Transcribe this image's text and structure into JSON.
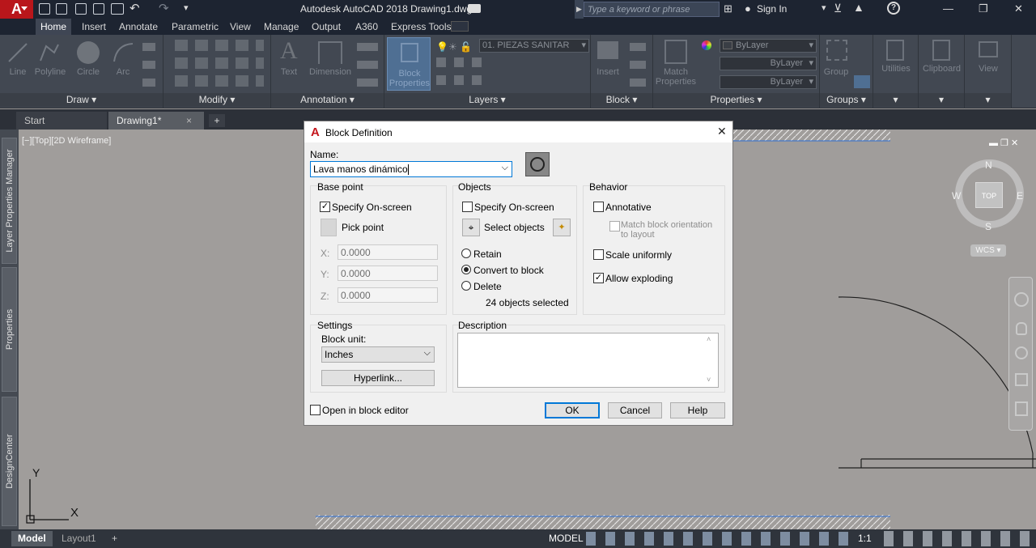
{
  "app": {
    "logo": "A",
    "title": "Autodesk AutoCAD 2018    Drawing1.dwg",
    "search_placeholder": "Type a keyword or phrase",
    "sign_in": "Sign In"
  },
  "ribbon": {
    "tabs": [
      "Home",
      "Insert",
      "Annotate",
      "Parametric",
      "View",
      "Manage",
      "Output",
      "A360",
      "Express Tools"
    ],
    "active_tab": "Home",
    "draw": {
      "label": "Draw",
      "tools": [
        "Line",
        "Polyline",
        "Circle",
        "Arc"
      ]
    },
    "modify": {
      "label": "Modify"
    },
    "annotation": {
      "label": "Annotation",
      "tools": [
        "Text",
        "Dimension"
      ]
    },
    "block_props": {
      "label": "Block Properties"
    },
    "layers": {
      "label": "Layers",
      "current": "01. PIEZAS SANITAR"
    },
    "block": {
      "label": "Block",
      "tools": [
        "Insert"
      ]
    },
    "properties": {
      "label": "Properties",
      "match": "Match Properties",
      "bylayer": "ByLayer"
    },
    "groups": {
      "label": "Groups",
      "group": "Group"
    },
    "utilities": "Utilities",
    "clipboard": "Clipboard",
    "view": "View"
  },
  "doc_tabs": {
    "start": "Start",
    "drawing": "Drawing1*",
    "close": "×",
    "add": "+"
  },
  "viewport": {
    "label": "[−][Top][2D Wireframe]",
    "compass": {
      "n": "N",
      "s": "S",
      "e": "E",
      "w": "W",
      "top": "TOP"
    },
    "wcs": "WCS",
    "ucs_x": "X",
    "ucs_y": "Y"
  },
  "palettes": [
    "Layer Properties Manager",
    "Properties",
    "DesignCenter"
  ],
  "status": {
    "model_tab": "Model",
    "layout_tab": "Layout1",
    "add": "+",
    "model": "MODEL",
    "scale": "1:1"
  },
  "dialog": {
    "title": "Block Definition",
    "close": "✕",
    "name_label": "Name:",
    "name_value": "Lava manos dinámico",
    "base_point": {
      "title": "Base point",
      "specify": "Specify On-screen",
      "specify_checked": true,
      "pick": "Pick point",
      "x_label": "X:",
      "y_label": "Y:",
      "z_label": "Z:",
      "x": "0.0000",
      "y": "0.0000",
      "z": "0.0000"
    },
    "objects": {
      "title": "Objects",
      "specify": "Specify On-screen",
      "specify_checked": false,
      "select": "Select objects",
      "retain": "Retain",
      "convert": "Convert to block",
      "delete": "Delete",
      "selected_choice": "convert",
      "count": "24 objects selected"
    },
    "behavior": {
      "title": "Behavior",
      "annotative": "Annotative",
      "annotative_checked": false,
      "match_orientation": "Match block orientation to layout",
      "scale_uniformly": "Scale uniformly",
      "scale_checked": false,
      "allow_exploding": "Allow exploding",
      "explode_checked": true
    },
    "settings": {
      "title": "Settings",
      "block_unit_label": "Block unit:",
      "block_unit": "Inches",
      "hyperlink": "Hyperlink..."
    },
    "description": {
      "title": "Description",
      "value": ""
    },
    "open_in_editor": "Open in block editor",
    "open_checked": false,
    "buttons": {
      "ok": "OK",
      "cancel": "Cancel",
      "help": "Help"
    }
  }
}
